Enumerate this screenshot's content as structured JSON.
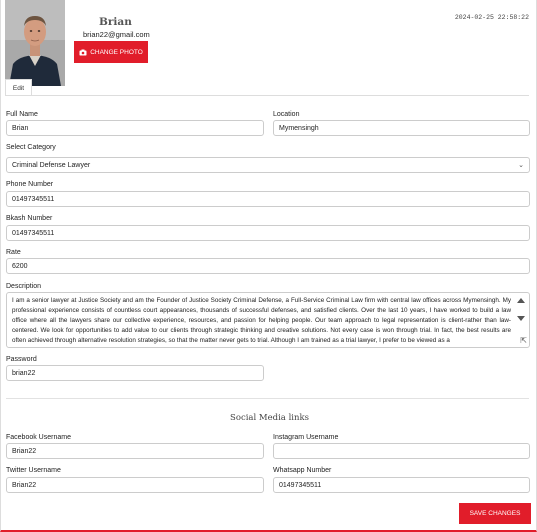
{
  "profile": {
    "name": "Brian",
    "email": "brian22@gmail.com",
    "change_photo_label": "CHANGE PHOTO",
    "timestamp": "2024-02-25 22:58:22"
  },
  "tabs": {
    "edit_label": "Edit"
  },
  "form": {
    "full_name": {
      "label": "Full Name",
      "value": "Brian"
    },
    "location": {
      "label": "Location",
      "value": "Mymensingh"
    },
    "category": {
      "label": "Select Category",
      "value": "Criminal Defense Lawyer"
    },
    "phone": {
      "label": "Phone Number",
      "value": "01497345511"
    },
    "bkash": {
      "label": "Bkash Number",
      "value": "01497345511"
    },
    "rate": {
      "label": "Rate",
      "value": "6200"
    },
    "description": {
      "label": "Description",
      "value": "I am a senior lawyer at Justice Society and am the Founder of Justice Society Criminal Defense, a Full-Service Criminal Law firm with central law offices across Mymensingh. My professional experience consists of countless court appearances, thousands of successful defenses, and satisfied clients. Over the last 10 years, I have worked to build a law office where all the lawyers share our collective experience, resources, and passion for helping people. Our team approach to legal representation is client-rather than law-centered. We look for opportunities to add value to our clients through strategic thinking and creative solutions. Not every case is won through trial. In fact, the best results are often achieved through alternative resolution strategies, so that the matter never gets to trial. Although I am trained as a trial lawyer, I prefer to be viewed as a"
    },
    "password": {
      "label": "Password",
      "value": "brian22"
    }
  },
  "social": {
    "title": "Social Media links",
    "facebook": {
      "label": "Facebook Username",
      "value": "Brian22"
    },
    "instagram": {
      "label": "Instagram Username",
      "value": ""
    },
    "twitter": {
      "label": "Twitter Username",
      "value": "Brian22"
    },
    "whatsapp": {
      "label": "Whatsapp Number",
      "value": "01497345511"
    }
  },
  "actions": {
    "save_label": "SAVE CHANGES"
  },
  "colors": {
    "accent": "#e11d2a"
  },
  "icons": {
    "camera": "camera-icon",
    "chevron": "chevron-down-icon"
  }
}
